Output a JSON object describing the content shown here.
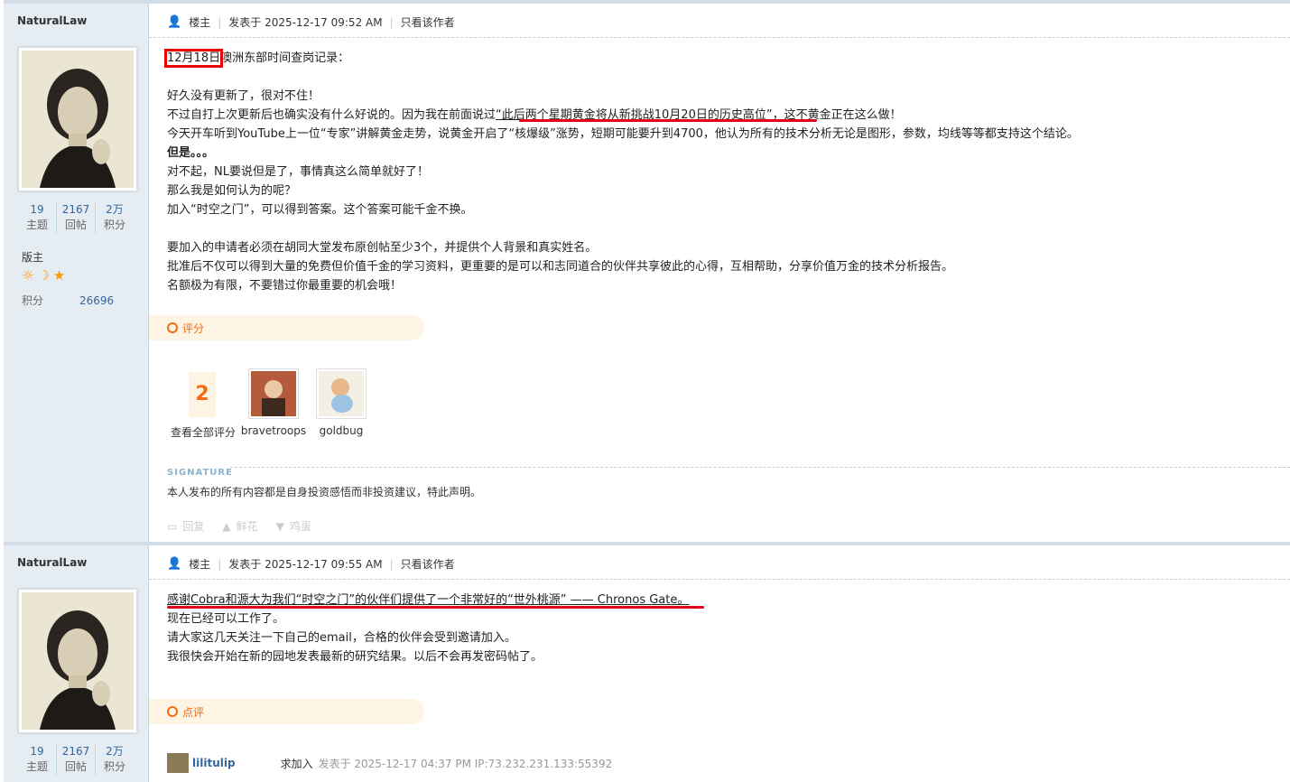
{
  "posts": [
    {
      "author": "NaturalLaw",
      "stats": [
        {
          "num": "19",
          "label": "主题"
        },
        {
          "num": "2167",
          "label": "回帖"
        },
        {
          "num": "2万",
          "label": "积分"
        }
      ],
      "group": "版主",
      "credit_label": "积分",
      "credit_value": "26696",
      "floor": "楼主",
      "posted": "发表于 2025-12-17 09:52 AM",
      "only_author": "只看该作者",
      "content": {
        "l1a": "12月18日",
        "l1b": "澳洲东部时间查岗记录：",
        "l2": "好久没有更新了，很对不住！",
        "l3a": "不过自打上次更新后也确实没有什么好说的。因为我在前面说过",
        "l3b": "“此后两个星期黄金将从新挑战10月20日的历史高位”",
        "l3c": "，这不黄金正在这么做！",
        "l4": "今天开车听到YouTube上一位“专家”讲解黄金走势，说黄金开启了“核爆级”涨势，短期可能要升到4700，他认为所有的技术分析无论是图形，参数，均线等等都支持这个结论。",
        "l5": "但是。。。",
        "l6": "对不起，NL要说但是了，事情真这么简单就好了！",
        "l7": "那么我是如何认为的呢？",
        "l8": "加入“时空之门”，可以得到答案。这个答案可能千金不换。",
        "l9": "要加入的申请者必须在胡同大堂发布原创帖至少3个，并提供个人背景和真实姓名。",
        "l10": "批准后不仅可以得到大量的免费但价值千金的学习资料，更重要的是可以和志同道合的伙伴共享彼此的心得，互相帮助，分享价值万金的技术分析报告。",
        "l11": "名额极为有限，不要错过你最重要的机会哦！"
      },
      "rating_label": "评分",
      "rating_count": "2",
      "rating_all": "查看全部评分",
      "raters": [
        "bravetroops",
        "goldbug"
      ],
      "signature_label": "SIGNATURE",
      "signature": "本人发布的所有内容都是自身投资感悟而非投资建议，特此声明。",
      "actions": [
        "回复",
        "鲜花",
        "鸡蛋"
      ]
    },
    {
      "author": "NaturalLaw",
      "stats": [
        {
          "num": "19",
          "label": "主题"
        },
        {
          "num": "2167",
          "label": "回帖"
        },
        {
          "num": "2万",
          "label": "积分"
        }
      ],
      "floor": "楼主",
      "posted": "发表于 2025-12-17 09:55 AM",
      "only_author": "只看该作者",
      "content": {
        "l1": "感谢Cobra和源大为我们“时空之门”的伙伴们提供了一个非常好的“世外桃源” —— Chronos Gate。",
        "l2": "现在已经可以工作了。",
        "l3": "请大家这几天关注一下自己的email，合格的伙伴会受到邀请加入。",
        "l4": "我很快会开始在新的园地发表最新的研究结果。以后不会再发密码帖了。"
      },
      "comment_label": "点评",
      "comment": {
        "user": "lilitulip",
        "action": "求加入",
        "meta": "发表于 2025-12-17 04:37 PM IP:73.232.231.133:55392"
      }
    }
  ]
}
